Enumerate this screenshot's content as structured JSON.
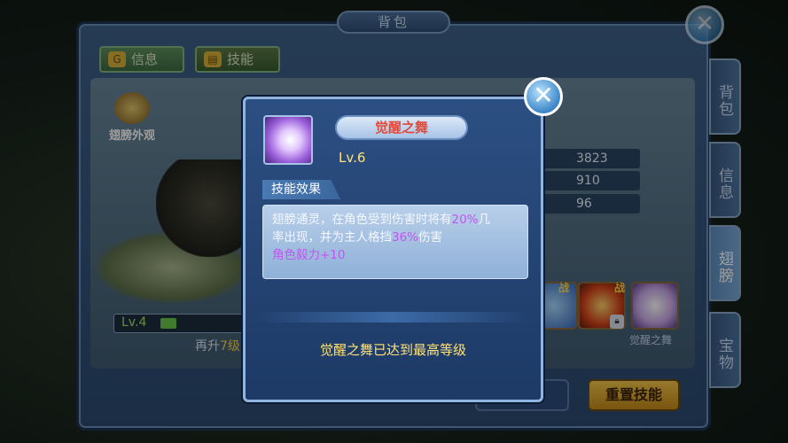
{
  "window": {
    "title": "背包"
  },
  "top_tabs": [
    {
      "label": "信息",
      "icon": "info-icon"
    },
    {
      "label": "技能",
      "icon": "skill-book-icon"
    }
  ],
  "wing": {
    "appearance_label": "翅膀外观",
    "level": "Lv.4",
    "level_progress": 0.2,
    "upgrade_hint_prefix": "再升",
    "upgrade_hint_num": "7级"
  },
  "stats": [
    "3823",
    "910",
    "96"
  ],
  "skills": {
    "battle_label": "战",
    "awaken_caption": "觉醒之舞"
  },
  "buttons": {
    "reset": "重置技能"
  },
  "side_tabs": [
    "背包",
    "信息",
    "翅膀",
    "宝物"
  ],
  "popup": {
    "skill_name": "觉醒之舞",
    "level": "Lv.6",
    "effect_header": "技能效果",
    "effect_line1_a": "翅膀通灵，在角色受到伤害时将有",
    "effect_line1_pct": "20%",
    "effect_line1_b": "几",
    "effect_line2_a": "率出现，并为主人格挡",
    "effect_line2_pct": "36%",
    "effect_line2_b": "伤害",
    "effect_line3": "角色毅力+10",
    "max_level_text": "觉醒之舞已达到最高等级"
  },
  "colors": {
    "accent_gold": "#ffe27a",
    "highlight_purple": "#c255f0",
    "panel_blue": "#1d3a66"
  }
}
